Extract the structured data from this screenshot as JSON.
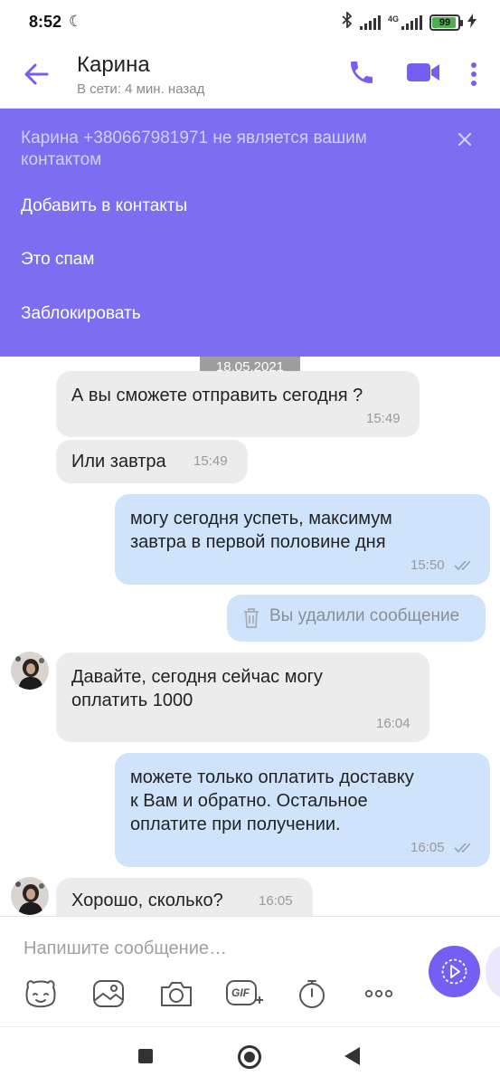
{
  "status_bar": {
    "time": "8:52",
    "network_type": "4G",
    "battery_level": "99",
    "battery_color": "#4caf50"
  },
  "header": {
    "contact_name": "Карина",
    "contact_status": "В сети: 4 мин. назад",
    "icons": [
      "back-arrow-icon",
      "phone-icon",
      "video-camera-icon",
      "more-vertical-icon"
    ],
    "accent_color": "#7360f2"
  },
  "spam_banner": {
    "text": "Карина +380667981971 не является вашим контактом",
    "background": "#7c6ef0",
    "actions": [
      {
        "label": "Добавить в контакты"
      },
      {
        "label": "Это спам"
      },
      {
        "label": "Заблокировать"
      }
    ]
  },
  "chat": {
    "date_separator": "18.05.2021",
    "messages": [
      {
        "direction": "in",
        "lines": [
          "А вы сможете отправить сегодня ?"
        ],
        "time": "15:49"
      },
      {
        "direction": "in",
        "lines": [
          "Или завтра"
        ],
        "time": "15:49"
      },
      {
        "direction": "out",
        "lines": [
          "могу сегодня успеть, максимум",
          "завтра в первой половине дня"
        ],
        "time": "15:50",
        "read": true
      },
      {
        "direction": "out",
        "deleted": true,
        "text": "Вы удалили сообщение"
      },
      {
        "direction": "in",
        "lines": [
          "Давайте, сегодня сейчас могу",
          "оплатить 1000"
        ],
        "time": "16:04",
        "avatar": true
      },
      {
        "direction": "out",
        "lines": [
          "можете только оплатить доставку",
          "к Вам и обратно. Остальное",
          "оплатите при получении."
        ],
        "time": "16:05",
        "read": true
      },
      {
        "direction": "in",
        "lines": [
          "Хорошо, сколько?"
        ],
        "time": "16:05",
        "avatar": true
      }
    ],
    "incoming_color": "#ececec",
    "outgoing_color": "#cfe3fb"
  },
  "composer": {
    "placeholder": "Напишите сообщение…",
    "tools": [
      "sticker-icon",
      "gallery-icon",
      "camera-icon",
      "gif-icon",
      "timer-icon",
      "more-horizontal-icon"
    ],
    "gif_label": "GIF",
    "send_icon": "send-arrow-icon"
  },
  "nav_bar": {
    "buttons": [
      "recents-square-icon",
      "home-circle-icon",
      "back-triangle-icon"
    ]
  }
}
